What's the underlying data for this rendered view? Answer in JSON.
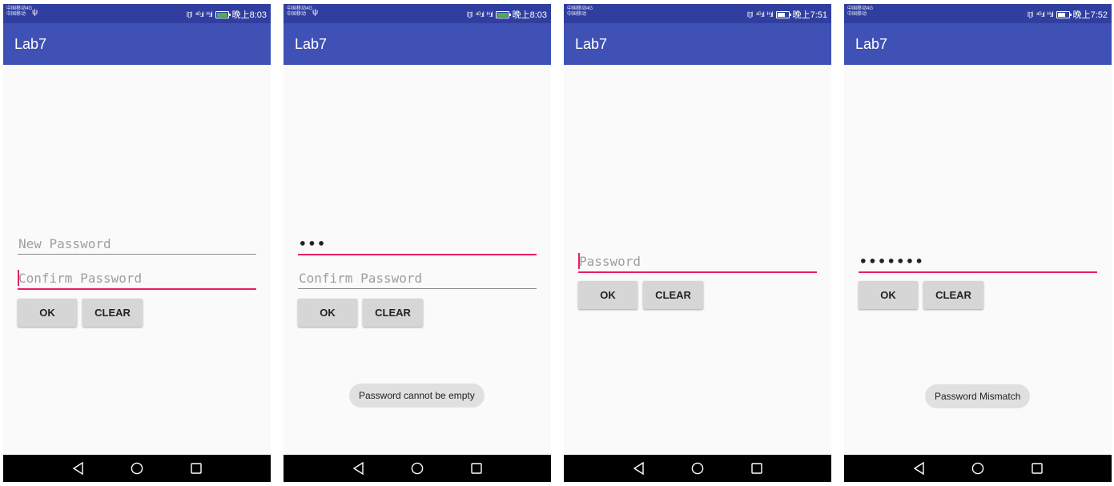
{
  "screens": [
    {
      "status": {
        "carrier_line1": "中国移动4G",
        "carrier_line2": "中国移动",
        "usb": "ψ",
        "vibrate": "ǀ▯ǀ",
        "signal1": "⁴ᴳ.ıl",
        "signal2": "ᴴ.ıl",
        "time": "晚上8:03",
        "battery_level": 1.0,
        "battery_color": "#4caf50"
      },
      "app_title": "Lab7",
      "fields": [
        {
          "placeholder": "New Password",
          "value": ""
        },
        {
          "placeholder": "Confirm Password",
          "value": ""
        }
      ],
      "ok_label": "OK",
      "clear_label": "CLEAR",
      "toast": "",
      "nav": {
        "back": "back-icon",
        "home": "home-icon",
        "recents": "recents-icon"
      }
    },
    {
      "status": {
        "carrier_line1": "中国移动4G",
        "carrier_line2": "中国移动",
        "usb": "ψ",
        "vibrate": "ǀ▯ǀ",
        "signal1": "⁴ᴳ.ıl",
        "signal2": "ᴴ.ıl",
        "time": "晚上8:03",
        "battery_level": 1.0,
        "battery_color": "#4caf50"
      },
      "app_title": "Lab7",
      "fields": [
        {
          "placeholder": "New Password",
          "value": "•••"
        },
        {
          "placeholder": "Confirm Password",
          "value": ""
        }
      ],
      "ok_label": "OK",
      "clear_label": "CLEAR",
      "toast": "Password cannot be empty",
      "nav": {
        "back": "back-icon",
        "home": "home-icon",
        "recents": "recents-icon"
      }
    },
    {
      "status": {
        "carrier_line1": "中国移动4G",
        "carrier_line2": "中国移动",
        "usb": "",
        "vibrate": "ǀ▯ǀ",
        "signal1": "⁴ᴳ.ıl",
        "signal2": "ᴴ.ıl",
        "time": "晚上7:51",
        "battery_level": 0.7,
        "battery_color": "#ffffff"
      },
      "app_title": "Lab7",
      "fields": [
        {
          "placeholder": "Password",
          "value": ""
        }
      ],
      "ok_label": "OK",
      "clear_label": "CLEAR",
      "toast": "",
      "nav": {
        "back": "back-icon",
        "home": "home-icon",
        "recents": "recents-icon"
      }
    },
    {
      "status": {
        "carrier_line1": "中国移动4G",
        "carrier_line2": "中国移动",
        "usb": "",
        "vibrate": "ǀ▯ǀ",
        "signal1": "⁴ᴳ.ıl",
        "signal2": "ᴴ.ıl",
        "time": "晚上7:52",
        "battery_level": 0.7,
        "battery_color": "#ffffff"
      },
      "app_title": "Lab7",
      "fields": [
        {
          "placeholder": "Password",
          "value": "•••••••"
        }
      ],
      "ok_label": "OK",
      "clear_label": "CLEAR",
      "toast": "Password Mismatch",
      "nav": {
        "back": "back-icon",
        "home": "home-icon",
        "recents": "recents-icon"
      }
    }
  ]
}
